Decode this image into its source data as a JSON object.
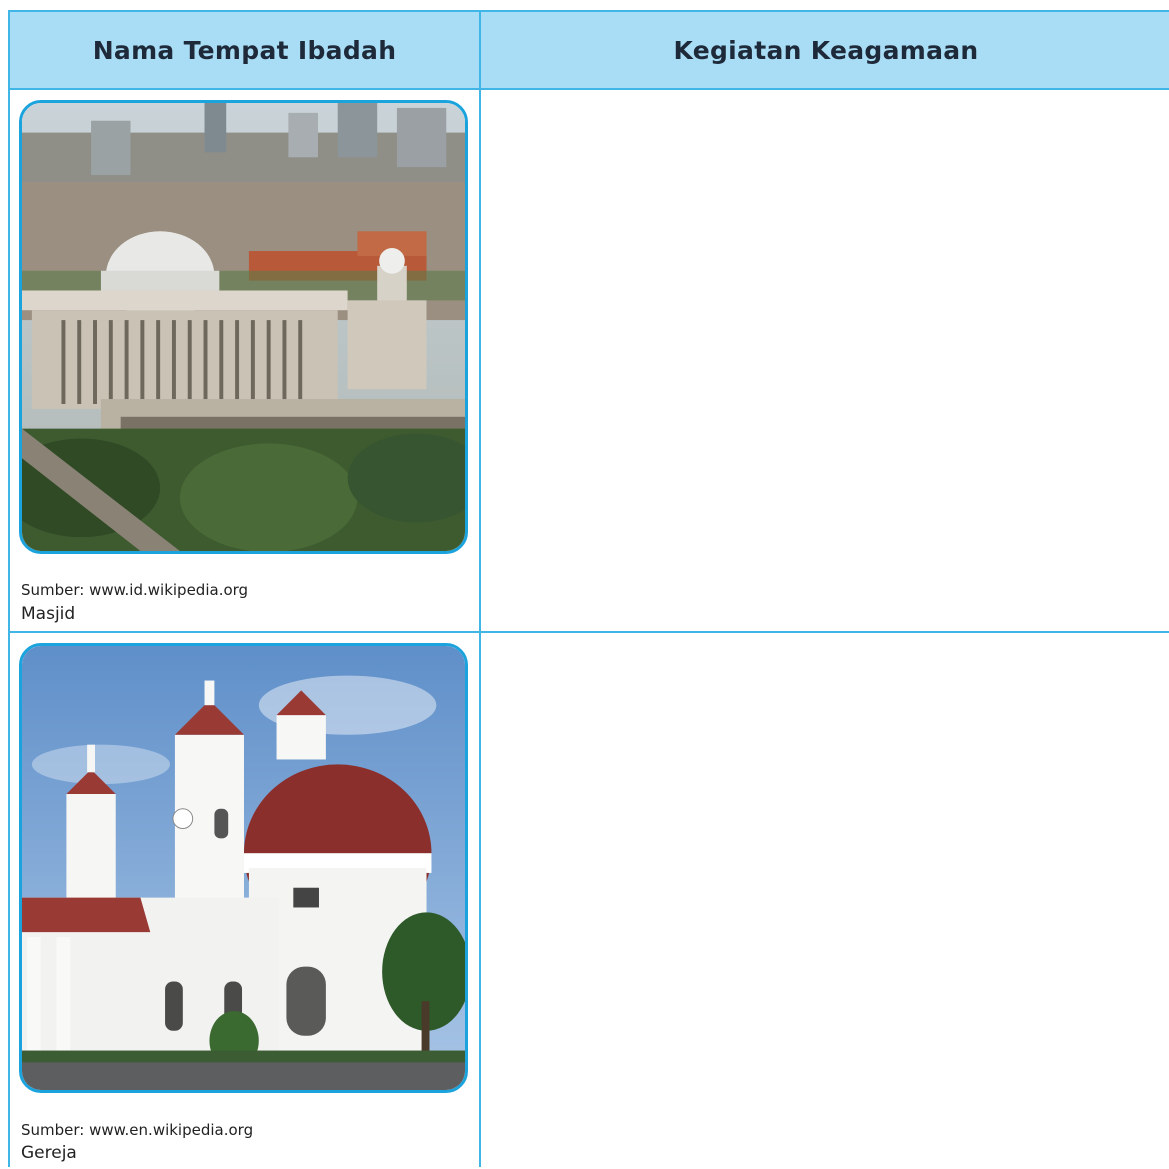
{
  "table": {
    "headers": [
      "Nama Tempat Ibadah",
      "Kegiatan Keagamaan"
    ],
    "rows": [
      {
        "image_icon": "mosque-photo",
        "source": "Sumber: www.id.wikipedia.org",
        "name": "Masjid",
        "activity": ""
      },
      {
        "image_icon": "church-photo",
        "source": "Sumber: www.en.wikipedia.org",
        "name": "Gereja",
        "activity": ""
      }
    ]
  },
  "colors": {
    "header_bg": "#a9ddf5",
    "border": "#3fb6e6",
    "photo_frame": "#1aa3dc"
  }
}
